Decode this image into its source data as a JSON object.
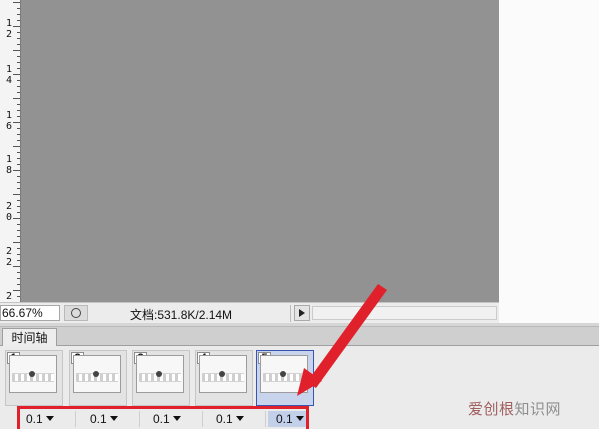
{
  "ruler": {
    "labels": [
      {
        "d1": "1",
        "d2": "2"
      },
      {
        "d1": "1",
        "d2": "4"
      },
      {
        "d1": "1",
        "d2": "6"
      },
      {
        "d1": "1",
        "d2": "8"
      },
      {
        "d1": "2",
        "d2": "0"
      },
      {
        "d1": "2",
        "d2": "2"
      },
      {
        "d1": "2",
        "d2": ""
      }
    ]
  },
  "status_bar": {
    "zoom": "66.67%",
    "doc_info": "文档:531.8K/2.14M"
  },
  "panel": {
    "tab_label": "时间轴"
  },
  "frames": [
    {
      "number": "1",
      "delay": "0.1",
      "selected": false
    },
    {
      "number": "2",
      "delay": "0.1",
      "selected": false
    },
    {
      "number": "3",
      "delay": "0.1",
      "selected": false
    },
    {
      "number": "4",
      "delay": "0.1",
      "selected": false
    },
    {
      "number": "5",
      "delay": "0.1",
      "selected": true
    }
  ],
  "annotation": {
    "color": "#e0202a"
  },
  "watermark": {
    "text_accent": "爱创根",
    "text_rest": "知识网"
  },
  "colors": {
    "canvas": "#929292",
    "selection": "#c8d4ec"
  }
}
